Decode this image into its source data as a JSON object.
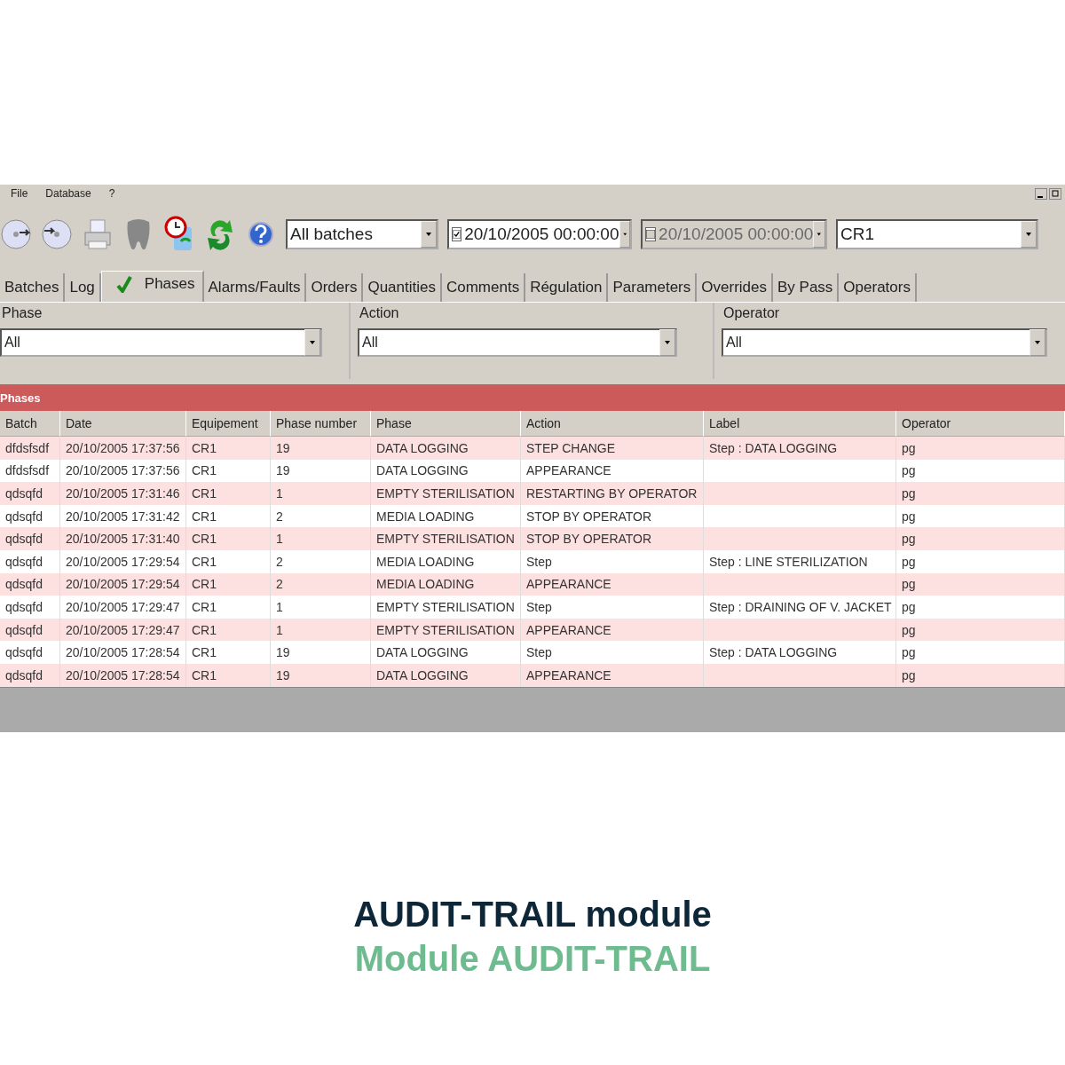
{
  "window": {
    "menu": [
      "File",
      "Database",
      "?"
    ]
  },
  "toolbar": {
    "icons": [
      {
        "kind": "cd-left"
      },
      {
        "kind": "cd-right"
      },
      {
        "kind": "printer"
      },
      {
        "kind": "shape"
      },
      {
        "kind": "clock"
      },
      {
        "kind": "refresh"
      },
      {
        "kind": "help"
      }
    ],
    "batch_filter": {
      "value": "All batches"
    },
    "date_from": {
      "value": "20/10/2005 00:00:00",
      "checked": true
    },
    "date_to": {
      "value": "20/10/2005 00:00:00",
      "checked": false
    },
    "equipment": {
      "value": "CR1"
    }
  },
  "tabs": [
    {
      "label": "Batches",
      "selected": false
    },
    {
      "label": "Log",
      "selected": false
    },
    {
      "label": "Phases",
      "selected": true
    },
    {
      "label": "Alarms/Faults",
      "selected": false
    },
    {
      "label": "Orders",
      "selected": false
    },
    {
      "label": "Quantities",
      "selected": false
    },
    {
      "label": "Comments",
      "selected": false
    },
    {
      "label": "Régulation",
      "selected": false
    },
    {
      "label": "Parameters",
      "selected": false
    },
    {
      "label": "Overrides",
      "selected": false
    },
    {
      "label": "By Pass",
      "selected": false
    },
    {
      "label": "Operators",
      "selected": false
    }
  ],
  "filters": [
    {
      "label": "Phase",
      "value": "All"
    },
    {
      "label": "Action",
      "value": "All"
    },
    {
      "label": "Operator",
      "value": "All"
    }
  ],
  "table": {
    "title": "Phases",
    "columns": [
      "Batch",
      "Date",
      "Equipement",
      "Phase number",
      "Phase",
      "Action",
      "Label",
      "Operator"
    ],
    "rows": [
      [
        "dfdsfsdf",
        "20/10/2005 17:37:56",
        "CR1",
        "19",
        "DATA LOGGING",
        "STEP CHANGE",
        "Step : DATA LOGGING",
        "pg"
      ],
      [
        "dfdsfsdf",
        "20/10/2005 17:37:56",
        "CR1",
        "19",
        "DATA LOGGING",
        "APPEARANCE",
        "",
        "pg"
      ],
      [
        "qdsqfd",
        "20/10/2005 17:31:46",
        "CR1",
        "1",
        "EMPTY STERILISATION",
        "RESTARTING BY OPERATOR",
        "",
        "pg"
      ],
      [
        "qdsqfd",
        "20/10/2005 17:31:42",
        "CR1",
        "2",
        "MEDIA LOADING",
        "STOP BY OPERATOR",
        "",
        "pg"
      ],
      [
        "qdsqfd",
        "20/10/2005 17:31:40",
        "CR1",
        "1",
        "EMPTY STERILISATION",
        "STOP BY OPERATOR",
        "",
        "pg"
      ],
      [
        "qdsqfd",
        "20/10/2005 17:29:54",
        "CR1",
        "2",
        "MEDIA LOADING",
        "Step",
        "Step : LINE STERILIZATION",
        "pg"
      ],
      [
        "qdsqfd",
        "20/10/2005 17:29:54",
        "CR1",
        "2",
        "MEDIA LOADING",
        "APPEARANCE",
        "",
        "pg"
      ],
      [
        "qdsqfd",
        "20/10/2005 17:29:47",
        "CR1",
        "1",
        "EMPTY STERILISATION",
        "Step",
        "Step : DRAINING OF V. JACKET",
        "pg"
      ],
      [
        "qdsqfd",
        "20/10/2005 17:29:47",
        "CR1",
        "1",
        "EMPTY STERILISATION",
        "APPEARANCE",
        "",
        "pg"
      ],
      [
        "qdsqfd",
        "20/10/2005 17:28:54",
        "CR1",
        "19",
        "DATA LOGGING",
        "Step",
        "Step : DATA LOGGING",
        "pg"
      ],
      [
        "qdsqfd",
        "20/10/2005 17:28:54",
        "CR1",
        "19",
        "DATA LOGGING",
        "APPEARANCE",
        "",
        "pg"
      ]
    ]
  },
  "caption": {
    "title": "AUDIT-TRAIL module",
    "subtitle": "Module AUDIT-TRAIL"
  }
}
